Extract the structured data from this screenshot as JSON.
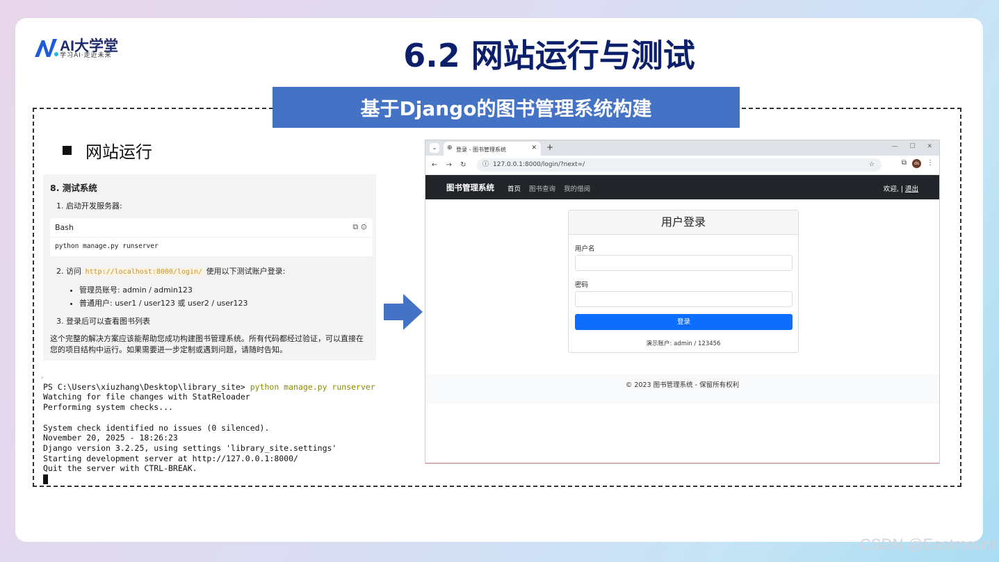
{
  "logo": {
    "name": "AI大学堂",
    "tagline": "学习AI·走近未来"
  },
  "title": "6.2 网站运行与测试",
  "banner": "基于Django的图书管理系统构建",
  "section_heading": "网站运行",
  "doc": {
    "heading": "8. 测试系统",
    "step1": "1. 启动开发服务器:",
    "code_lang": "Bash",
    "code_icons": "⧉ ⊙",
    "code": "python manage.py runserver",
    "step2_prefix": "2. 访问",
    "step2_link": "http://localhost:8000/login/",
    "step2_suffix": "使用以下测试账户登录:",
    "bullets": [
      "管理员账号: admin / admin123",
      "普通用户: user1 / user123 或 user2 / user123"
    ],
    "step3": "3. 登录后可以查看图书列表",
    "paragraph": "这个完整的解决方案应该能帮助您成功构建图书管理系统。所有代码都经过验证，可以直接在您的项目结构中运行。如果需要进一步定制或遇到问题，请随时告知。"
  },
  "terminal": {
    "prompt": "PS C:\\Users\\xiuzhang\\Desktop\\library_site> ",
    "command": "python manage.py runserver",
    "lines": [
      "Watching for file changes with StatReloader",
      "Performing system checks...",
      "",
      "System check identified no issues (0 silenced).",
      "November 20, 2025 - 18:26:23",
      "Django version 3.2.25, using settings 'library_site.settings'",
      "Starting development server at http://127.0.0.1:8000/",
      "Quit the server with CTRL-BREAK."
    ]
  },
  "browser": {
    "tab_title": "登录 - 图书管理系统",
    "url": "127.0.0.1:8000/login/?next=/",
    "avatar": "ds",
    "navbar": {
      "brand": "图书管理系统",
      "links": [
        "首页",
        "图书查询",
        "我的借阅"
      ],
      "welcome": "欢迎, |",
      "logout": "退出"
    },
    "login": {
      "title": "用户登录",
      "username_label": "用户名",
      "password_label": "密码",
      "submit": "登录",
      "demo": "演示账户: admin / 123456"
    },
    "footer": "© 2023 图书管理系统 - 保留所有权利"
  },
  "watermark": "CSDN @Eastmount",
  "colors": {
    "title": "#0c1f6b",
    "banner": "#4472c4",
    "arrow": "#4472c4",
    "primary_button": "#0d6efd",
    "navbar": "#212529"
  }
}
